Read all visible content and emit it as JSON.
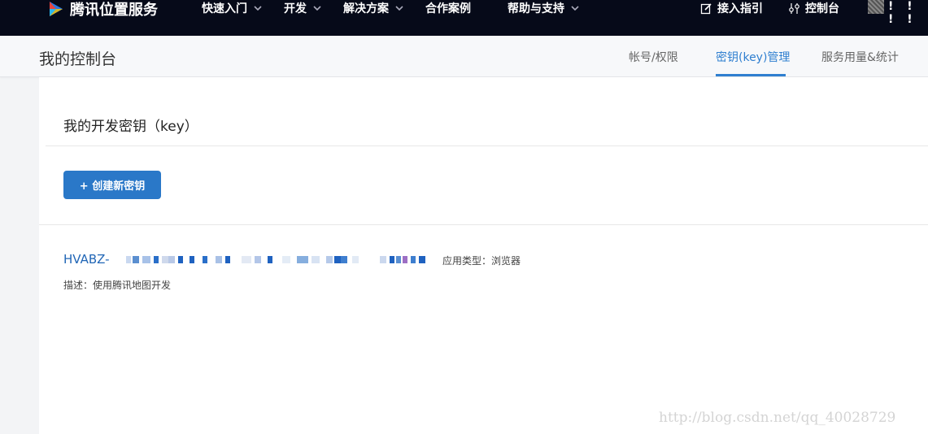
{
  "nav": {
    "brand": "腾讯位置服务",
    "items": [
      {
        "label": "快速入门",
        "has_dropdown": true
      },
      {
        "label": "开发",
        "has_dropdown": true
      },
      {
        "label": "解决方案",
        "has_dropdown": true
      },
      {
        "label": "合作案例",
        "has_dropdown": false
      },
      {
        "label": "帮助与支持",
        "has_dropdown": true
      }
    ],
    "access_guide": "接入指引",
    "console": "控制台",
    "user_suffix": "! ! ! !"
  },
  "subheader": {
    "title": "我的控制台",
    "tabs": [
      {
        "label": "帐号/权限",
        "active": false
      },
      {
        "label": "密钥(key)管理",
        "active": true
      },
      {
        "label": "服务用量&统计",
        "active": false
      }
    ]
  },
  "main": {
    "section_title": "我的开发密钥（key）",
    "create_button": "+ 创建新密钥",
    "key": {
      "prefix": "HVABZ-",
      "app_type": "应用类型：浏览器",
      "description": "描述：使用腾讯地图开发"
    }
  },
  "watermark": "http://blog.csdn.net/qq_40028729",
  "colors": {
    "nav_bg": "#060a19",
    "accent": "#2f7fd0",
    "button": "#2a78c8",
    "key_link": "#2166b6"
  }
}
